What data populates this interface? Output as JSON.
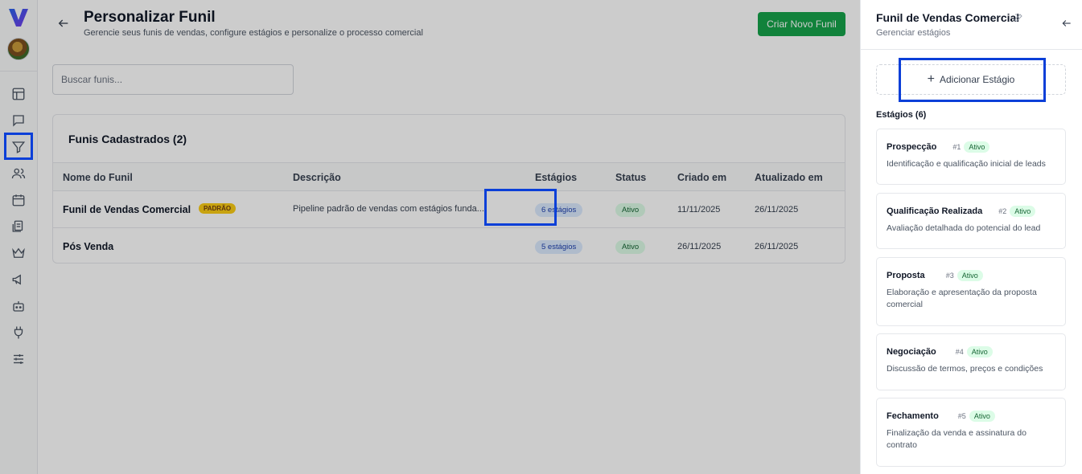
{
  "header": {
    "title": "Personalizar Funil",
    "subtitle": "Gerencie seus funis de vendas, configure estágios e personalize o processo comercial",
    "create_button": "Criar Novo Funil"
  },
  "search": {
    "placeholder": "Buscar funis..."
  },
  "table": {
    "title": "Funis Cadastrados (2)",
    "columns": [
      "Nome do Funil",
      "Descrição",
      "Estágios",
      "Status",
      "Criado em",
      "Atualizado em"
    ],
    "rows": [
      {
        "name": "Funil de Vendas Comercial",
        "badge": "PADRÃO",
        "description": "Pipeline padrão de vendas com estágios funda...",
        "stages": "6 estágios",
        "status": "Ativo",
        "created": "11/11/2025",
        "updated": "26/11/2025"
      },
      {
        "name": "Pós Venda",
        "badge": "",
        "description": "",
        "stages": "5 estágios",
        "status": "Ativo",
        "created": "26/11/2025",
        "updated": "26/11/2025"
      }
    ]
  },
  "panel": {
    "title": "Funil de Vendas Comercial",
    "subtitle": "Gerenciar estágios",
    "add_stage": "Adicionar Estágio",
    "stages_label": "Estágios (6)",
    "stages": [
      {
        "name": "Prospecção",
        "num": "#1",
        "status": "Ativo",
        "description": "Identificação e qualificação inicial de leads"
      },
      {
        "name": "Qualificação Realizada",
        "num": "#2",
        "status": "Ativo",
        "description": "Avaliação detalhada do potencial do lead"
      },
      {
        "name": "Proposta",
        "num": "#3",
        "status": "Ativo",
        "description": "Elaboração e apresentação da proposta comercial"
      },
      {
        "name": "Negociação",
        "num": "#4",
        "status": "Ativo",
        "description": "Discussão de termos, preços e condições"
      },
      {
        "name": "Fechamento",
        "num": "#5",
        "status": "Ativo",
        "description": "Finalização da venda e assinatura do contrato"
      }
    ]
  },
  "colors": {
    "accent_green": "#16a34a",
    "highlight_blue": "#0b3fd8",
    "padrao_yellow": "#facc15"
  }
}
